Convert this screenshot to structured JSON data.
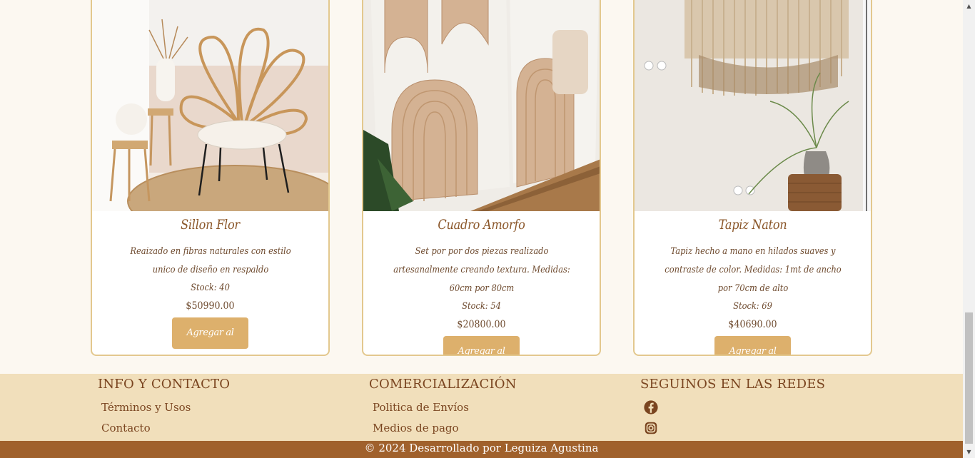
{
  "products": [
    {
      "title": "Sillon Flor",
      "description": "Reaizado en fibras naturales con estilo unico de diseño en respaldo",
      "stock": "Stock: 40",
      "price": "$50990.00",
      "button": "Agregar al carrito",
      "image_alt": "Sillón de ratán con forma de flor junto a macetas de fibras naturales"
    },
    {
      "title": "Cuadro Amorfo",
      "description": "Set por por dos piezas realizado artesanalmente creando textura. Medidas: 60cm por 80cm",
      "stock": "Stock: 54",
      "price": "$20800.00",
      "button": "Agregar al carrito",
      "image_alt": "Dos cuadros con arcos en relieve color arena"
    },
    {
      "title": "Tapiz Naton",
      "description": "Tapiz hecho a mano en hilados suaves y contraste de color. Medidas: 1mt de ancho por 70cm de alto",
      "stock": "Stock: 69",
      "price": "$40690.00",
      "button": "Agregar al carrito",
      "image_alt": "Tapiz de flecos colgado sobre una pared con planta en maceta"
    }
  ],
  "footer": {
    "info": {
      "heading": "INFO Y CONTACTO",
      "links": [
        "Términos y Usos",
        "Contacto"
      ]
    },
    "commerce": {
      "heading": "COMERCIALIZACIÓN",
      "links": [
        "Politica de Envíos",
        "Medios de pago"
      ]
    },
    "social": {
      "heading": "SEGUINOS EN LAS REDES",
      "icons": [
        "facebook-icon",
        "instagram-icon"
      ]
    },
    "copyright": "© 2024 Desarrollado por Leguiza Agustina"
  },
  "colors": {
    "page_bg": "#fcf8f1",
    "card_border": "#e3c88e",
    "button_bg": "#ddb06c",
    "footer_bg": "#f1dfbb",
    "bottom_bar_bg": "#a0612c",
    "text_brown": "#7a4520"
  }
}
